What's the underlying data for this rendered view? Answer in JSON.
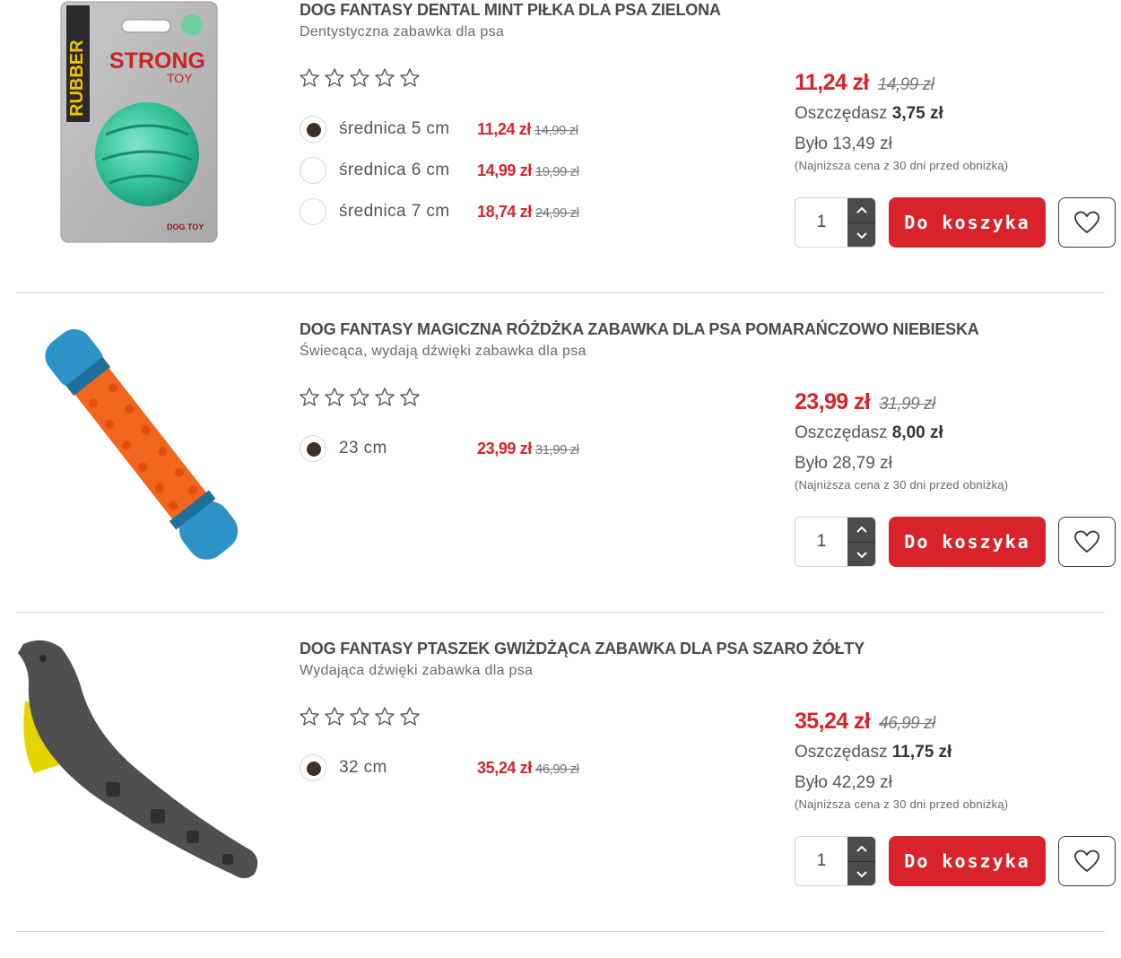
{
  "colors": {
    "accent": "#d8232a",
    "radio_dot": "#3d3027",
    "stepper": "#4b4b4b"
  },
  "products": [
    {
      "title": "DOG FANTASY DENTAL MINT PIŁKA DLA PSA ZIELONA",
      "subtitle": "Dentystyczna zabawka dla psa",
      "rating_stars": 0,
      "image_icon": "green-dental-ball-in-package",
      "variants": [
        {
          "label": "średnica 5 cm",
          "price": "11,24 zł",
          "old_price": "14,99 zł",
          "selected": true
        },
        {
          "label": "średnica 6 cm",
          "price": "14,99 zł",
          "old_price": "19,99 zł",
          "selected": false
        },
        {
          "label": "średnica 7 cm",
          "price": "18,74 zł",
          "old_price": "24,99 zł",
          "selected": false
        }
      ],
      "price": "11,24 zł",
      "old_price": "14,99 zł",
      "savings_label": "Oszczędasz",
      "savings_value": "3,75 zł",
      "was": "Było 13,49 zł",
      "lowest_note": "(Najniższa cena z 30 dni przed obniżką)",
      "quantity": "1",
      "cart_label": "Do koszyka"
    },
    {
      "title": "DOG FANTASY MAGICZNA RÓŻDŻKA ZABAWKA DLA PSA POMARAŃCZOWO NIEBIESKA",
      "subtitle": "Świecąca, wydają dźwięki zabawka dla psa",
      "rating_stars": 0,
      "image_icon": "orange-blue-wand-toy",
      "variants": [
        {
          "label": "23 cm",
          "price": "23,99 zł",
          "old_price": "31,99 zł",
          "selected": true
        }
      ],
      "price": "23,99 zł",
      "old_price": "31,99 zł",
      "savings_label": "Oszczędasz",
      "savings_value": "8,00 zł",
      "was": "Było 28,79 zł",
      "lowest_note": "(Najniższa cena z 30 dni przed obniżką)",
      "quantity": "1",
      "cart_label": "Do koszyka"
    },
    {
      "title": "DOG FANTASY PTASZEK GWIŻDŻĄCA ZABAWKA DLA PSA SZARO ŻÓŁTY",
      "subtitle": "Wydająca dźwięki zabawka dla psa",
      "rating_stars": 0,
      "image_icon": "grey-yellow-bird-toy",
      "variants": [
        {
          "label": "32 cm",
          "price": "35,24 zł",
          "old_price": "46,99 zł",
          "selected": true
        }
      ],
      "price": "35,24 zł",
      "old_price": "46,99 zł",
      "savings_label": "Oszczędasz",
      "savings_value": "11,75 zł",
      "was": "Było 42,29 zł",
      "lowest_note": "(Najniższa cena z 30 dni przed obniżką)",
      "quantity": "1",
      "cart_label": "Do koszyka"
    }
  ]
}
